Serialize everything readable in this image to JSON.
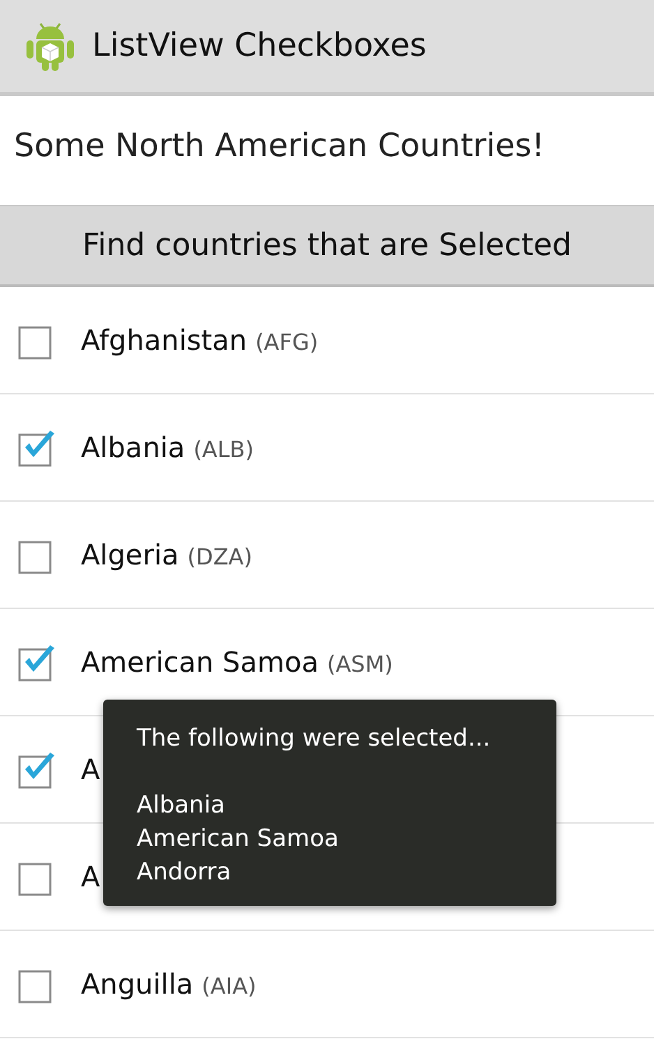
{
  "action_bar": {
    "title": "ListView Checkboxes"
  },
  "heading": "Some North American Countries!",
  "find_button": "Find countries that are Selected",
  "countries": [
    {
      "name": "Afghanistan",
      "code": "(AFG)",
      "checked": false
    },
    {
      "name": "Albania",
      "code": "(ALB)",
      "checked": true
    },
    {
      "name": "Algeria",
      "code": "(DZA)",
      "checked": false
    },
    {
      "name": "American Samoa",
      "code": "(ASM)",
      "checked": true
    },
    {
      "name": "A",
      "checked": true
    },
    {
      "name": "A",
      "checked": false
    },
    {
      "name": "Anguilla",
      "code": "(AIA)",
      "checked": false
    }
  ],
  "toast": {
    "title": "The following were selected...",
    "lines": [
      "Albania",
      "American Samoa",
      "Andorra"
    ]
  }
}
